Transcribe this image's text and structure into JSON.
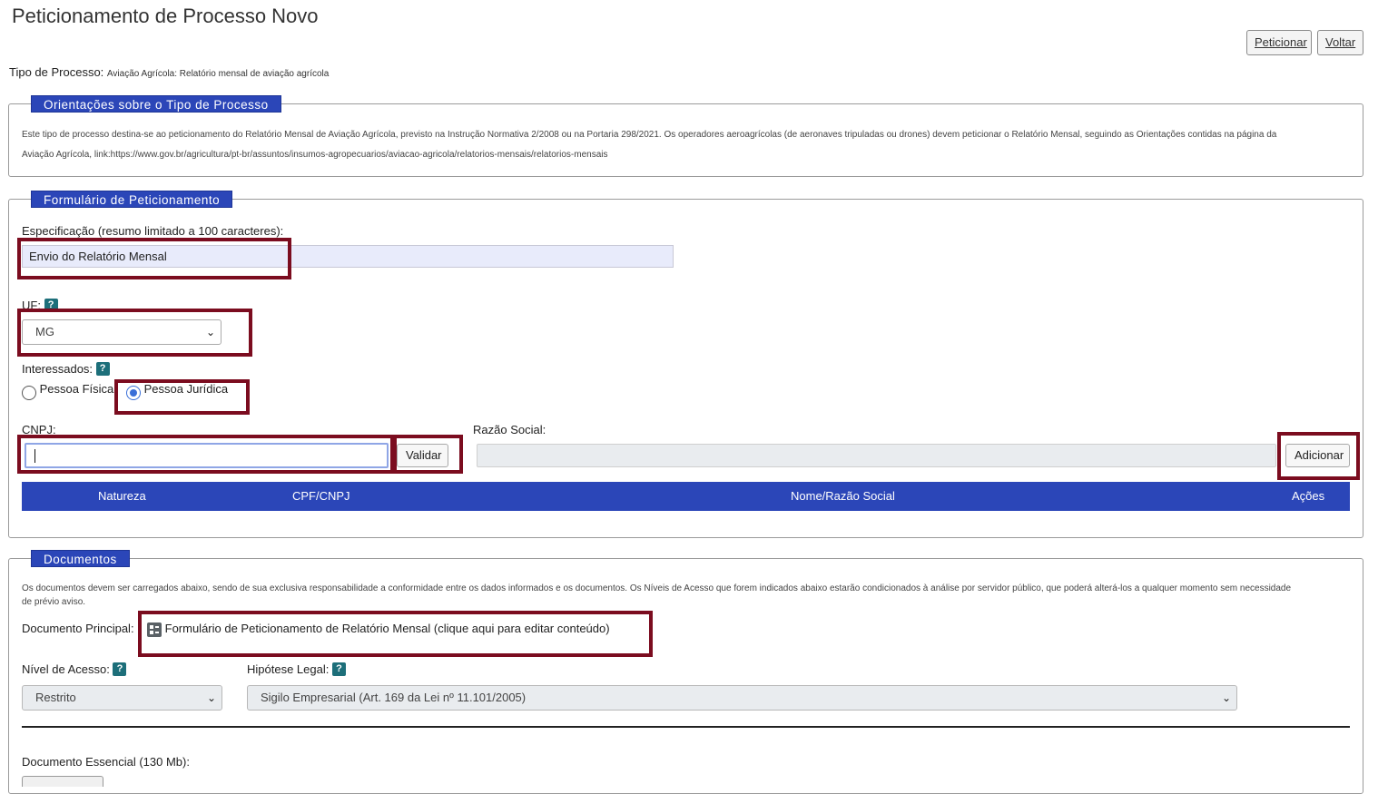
{
  "page": {
    "title": "Peticionamento de Processo Novo",
    "peticionar_label": "Peticionar",
    "voltar_label": "Voltar"
  },
  "tipo_processo": {
    "label": "Tipo de Processo:",
    "value": "Aviação Agrícola: Relatório mensal de aviação agrícola"
  },
  "orientacoes": {
    "legend": "Orientações sobre o Tipo de Processo",
    "line1": "Este tipo de processo destina-se ao peticionamento do Relatório Mensal de Aviação Agrícola, previsto na Instrução Normativa 2/2008 ou na Portaria 298/2021. Os operadores aeroagrícolas (de aeronaves tripuladas ou drones) devem peticionar o Relatório Mensal, seguindo as Orientações contidas na página da",
    "line2": "Aviação Agrícola, link:https://www.gov.br/agricultura/pt-br/assuntos/insumos-agropecuarios/aviacao-agricola/relatorios-mensais/relatorios-mensais"
  },
  "formulario": {
    "legend": "Formulário de Peticionamento",
    "especificacao_label": "Especificação (resumo limitado a 100 caracteres):",
    "especificacao_value": "Envio do Relatório Mensal",
    "uf_label": "UF:",
    "uf_value": "MG",
    "interessados_label": "Interessados:",
    "pessoa_fisica": "Pessoa Física",
    "pessoa_juridica": "Pessoa Jurídica",
    "cnpj_label": "CNPJ:",
    "cnpj_value": "",
    "validar_label": "Validar",
    "razao_social_label": "Razão Social:",
    "adicionar_label": "Adicionar",
    "table_headers": [
      "Natureza",
      "CPF/CNPJ",
      "Nome/Razão Social",
      "Ações"
    ]
  },
  "documentos": {
    "legend": "Documentos",
    "intro1": "Os documentos devem ser carregados abaixo, sendo de sua exclusiva responsabilidade a conformidade entre os dados informados e os documentos. Os Níveis de Acesso que forem indicados abaixo estarão condicionados à análise por servidor público, que poderá alterá-los a qualquer momento sem necessidade",
    "intro2": "de prévio aviso.",
    "principal_label": "Documento Principal:",
    "principal_link": "Formulário de Peticionamento de Relatório Mensal (clique aqui para editar conteúdo)",
    "nivel_label": "Nível de Acesso:",
    "nivel_value": "Restrito",
    "hipotese_label": "Hipótese Legal:",
    "hipotese_value": "Sigilo Empresarial (Art. 169 da Lei nº 11.101/2005)",
    "essencial_label": "Documento Essencial (130 Mb):"
  },
  "help_symbol": "?"
}
